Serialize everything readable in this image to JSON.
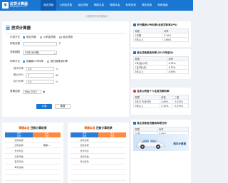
{
  "nav": {
    "logo_title": "房贷计算器",
    "logo_sub": "fangdaijisuan.com",
    "items": [
      "商业贷款",
      "公积金贷款",
      "组合贷款",
      "等额本息",
      "等额本金",
      "利率查询",
      "提前还款",
      "购房指南"
    ]
  },
  "subtitle": "计算房贷月供请拖动",
  "calc": {
    "title": "房贷计算器",
    "loan_type_label": "计算方式",
    "loan_type_options": [
      "商业贷款",
      "公积金贷款",
      "组合贷款"
    ],
    "amount_label": "贷款总额",
    "amount_value": "",
    "amount_unit": "万",
    "term_label": "贷款期限",
    "term_value": "30年(360期)",
    "rate_label": "利率方式",
    "rate_options": [
      "按最新LPR利率",
      "按旧版基准利率"
    ],
    "lpr_label": "首次利率",
    "lpr_value": "3.5",
    "lpr_unit": "%",
    "bp_label": "基点(BP)",
    "bp_value": "0",
    "bp_unit": "BP",
    "actual_label": "执行利率",
    "actual_value": "3.5",
    "actual_unit": "%",
    "date_label": "首期还款",
    "date_value": "May 2025",
    "calc_button": "计算",
    "reset_button": "重置"
  },
  "rate_cards": [
    {
      "title": "央行最新LPR利率(含房贷利率LPR)",
      "icon_color": "#1976d2",
      "headers": [
        "期限",
        "利率"
      ],
      "rows": [
        [
          "1年期",
          "3.10%"
        ],
        [
          "5年以上",
          "3.60%"
        ]
      ]
    },
    {
      "title": "商业贷款基准利率(2015年至今)",
      "icon_color": "#1976d2",
      "headers": [
        "期限",
        "利率"
      ],
      "rows": [
        [
          "1年(含)以内",
          "4.35%"
        ],
        [
          "1至5年(含)",
          "4.75%"
        ],
        [
          "5年以上",
          "4.90%"
        ]
      ]
    },
    {
      "title": "住房公积金个人住房贷款利率",
      "icon_color": "#e53935",
      "headers": [
        "期限",
        "首套",
        "二套"
      ],
      "rows": [
        [
          "5年以下(含5年)",
          "2.60%",
          "3.025%"
        ],
        [
          "5年以上",
          "3.10%",
          "3.575%"
        ]
      ]
    }
  ],
  "car": {
    "title": "商业贷款房贷缴纳年限分析",
    "headers": [
      "期限",
      "利率"
    ],
    "row": [
      "10年",
      "4.90%"
    ],
    "ad_label": "购车计算器"
  },
  "results": [
    {
      "prefix": "等额本金",
      "suffix": "还款计算结果",
      "sub_left": [
        "月均",
        "还款"
      ],
      "sub_right": [
        "首月",
        "还款"
      ],
      "rows": [
        [
          "贷款总额",
          ""
        ],
        [
          "还款总额",
          "等额..."
        ],
        [
          "支付利息",
          ""
        ],
        [
          "贷款月数",
          ""
        ],
        [
          "首月月供",
          ""
        ],
        [
          "每月递减",
          ""
        ],
        [
          "",
          ""
        ],
        [
          "",
          ""
        ]
      ]
    },
    {
      "prefix": "等额本息",
      "suffix": "还款计算结果",
      "sub_left": [
        "月均",
        "还款"
      ],
      "sub_right": [
        "首月",
        "还款"
      ],
      "rows": [
        [
          "贷款总额",
          ""
        ],
        [
          "还款总额",
          ""
        ],
        [
          "支付利息",
          ""
        ],
        [
          "贷款月数",
          ""
        ],
        [
          "月均还款",
          ""
        ],
        [
          "",
          ""
        ],
        [
          "",
          ""
        ],
        [
          "",
          ""
        ]
      ]
    }
  ]
}
